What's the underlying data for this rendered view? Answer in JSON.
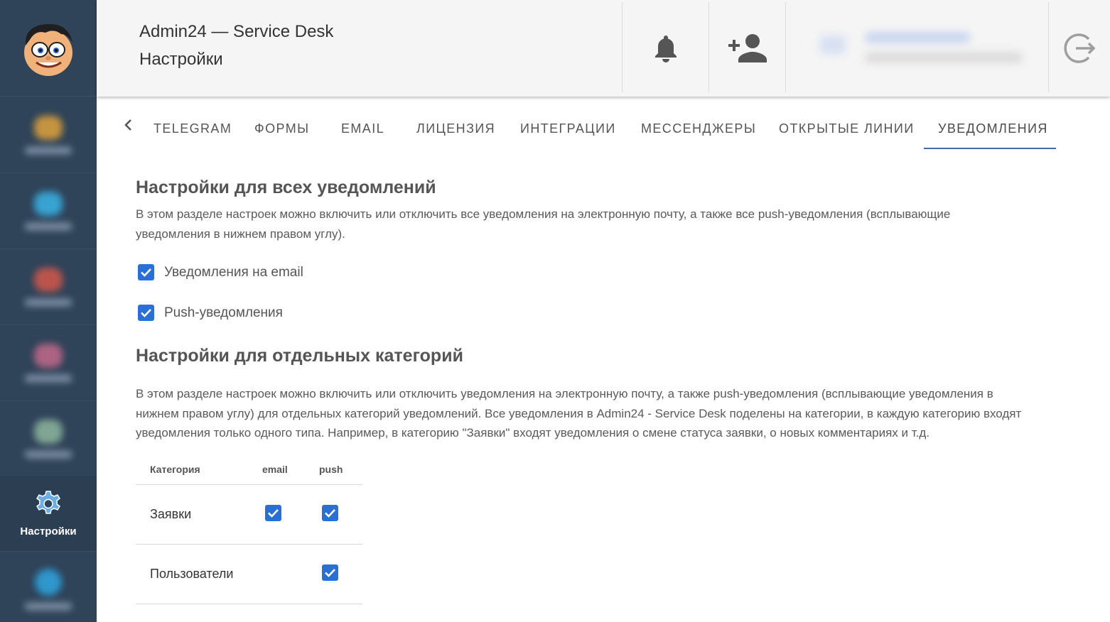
{
  "app": {
    "title": "Admin24 — Service Desk",
    "page": "Настройки"
  },
  "sidebar": {
    "active_label": "Настройки",
    "blurred_items": [
      {
        "icon": "blurred-icon",
        "color": "#e0a33a"
      },
      {
        "icon": "blurred-icon",
        "color": "#3ab4e8"
      },
      {
        "icon": "blurred-icon",
        "color": "#d4584a"
      },
      {
        "icon": "blurred-icon",
        "color": "#c46a8a"
      },
      {
        "icon": "blurred-icon",
        "color": "#8fb7a0"
      }
    ],
    "bottom_item": {
      "icon": "blurred-icon",
      "color": "#2fa6e0"
    }
  },
  "tabs": {
    "items": [
      "TELEGRAM",
      "ФОРМЫ",
      "EMAIL",
      "ЛИЦЕНЗИЯ",
      "ИНТЕГРАЦИИ",
      "МЕССЕНДЖЕРЫ",
      "ОТКРЫТЫЕ ЛИНИИ",
      "УВЕДОМЛЕНИЯ"
    ],
    "active": "УВЕДОМЛЕНИЯ"
  },
  "section_all": {
    "title": "Настройки для всех уведомлений",
    "description_line1": "В этом разделе настроек можно включить или отключить все уведомления на электронную почту, а также все push-уведомления (всплывающие",
    "description_line2": "уведомления в нижнем правом углу).",
    "checkboxes": [
      {
        "label": "Уведомления на email",
        "checked": true
      },
      {
        "label": "Push-уведомления",
        "checked": true
      }
    ]
  },
  "section_categories": {
    "title": "Настройки для отдельных категорий",
    "description_line1": "В этом разделе настроек можно включить или отключить уведомления на электронную почту, а также push-уведомления (всплывающие уведомления в",
    "description_line2": "нижнем правом углу) для отдельных категорий уведомлений. Все уведомления в Admin24 - Service Desk поделены на категории, в каждую категорию входят",
    "description_line3": "уведомления только одного типа. Например, в категорию \"Заявки\" входят уведомления о смене статуса заявки, о новых комментариях и т.д.",
    "table": {
      "headers": [
        "Категория",
        "email",
        "push"
      ],
      "rows": [
        {
          "category": "Заявки",
          "email": true,
          "push": true
        },
        {
          "category": "Пользователи",
          "email": false,
          "push": true
        }
      ]
    }
  },
  "colors": {
    "sidebar_bg": "#2f4359",
    "accent": "#3f6cad",
    "checkbox": "#2a6fd4"
  }
}
